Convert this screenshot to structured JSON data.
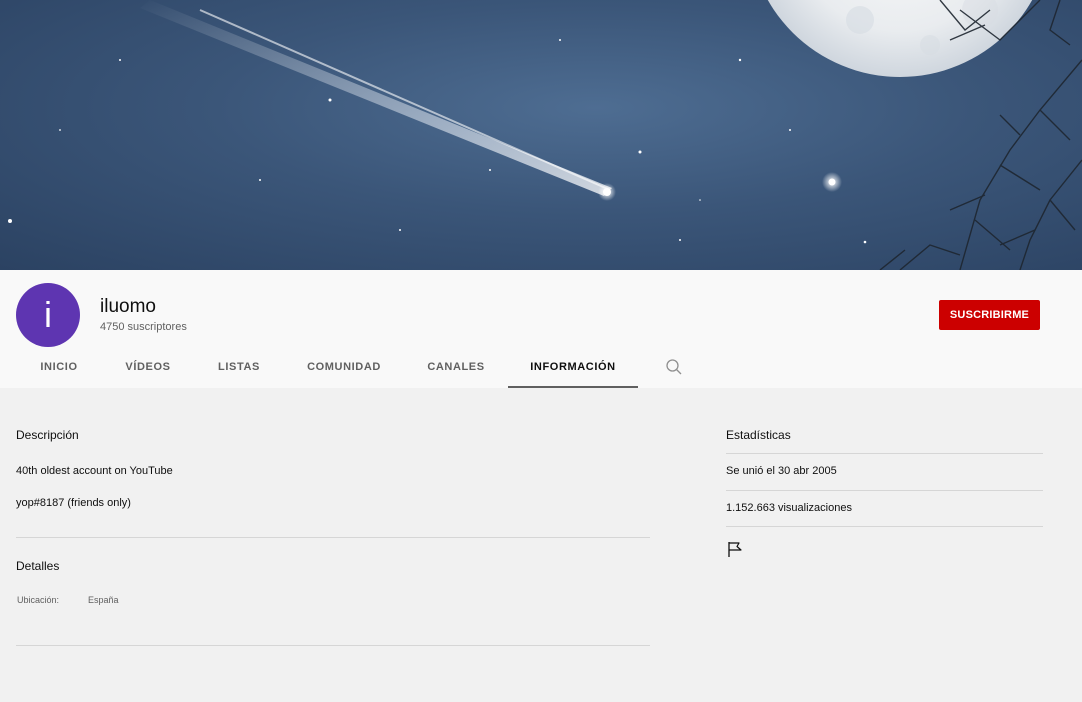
{
  "channel": {
    "avatar_letter": "i",
    "name": "iluomo",
    "subscribers": "4750 suscriptores",
    "subscribe_label": "SUSCRIBIRME"
  },
  "tabs": [
    {
      "label": "INICIO",
      "active": false
    },
    {
      "label": "VÍDEOS",
      "active": false
    },
    {
      "label": "LISTAS",
      "active": false
    },
    {
      "label": "COMUNIDAD",
      "active": false
    },
    {
      "label": "CANALES",
      "active": false
    },
    {
      "label": "INFORMACIÓN",
      "active": true
    }
  ],
  "about": {
    "description_title": "Descripción",
    "description_lines": [
      "40th oldest account on YouTube",
      "yop#8187 (friends only)"
    ],
    "details_title": "Detalles",
    "location_label": "Ubicación:",
    "location_value": "España"
  },
  "stats": {
    "title": "Estadísticas",
    "joined": "Se unió el 30 abr 2005",
    "views": "1.152.663 visualizaciones"
  },
  "icons": {
    "search": "search-icon",
    "flag": "flag-icon"
  },
  "colors": {
    "subscribe": "#cc0000",
    "avatar": "#5e35b1",
    "page_bg": "#f1f1f1",
    "header_bg": "#f9f9f9"
  }
}
